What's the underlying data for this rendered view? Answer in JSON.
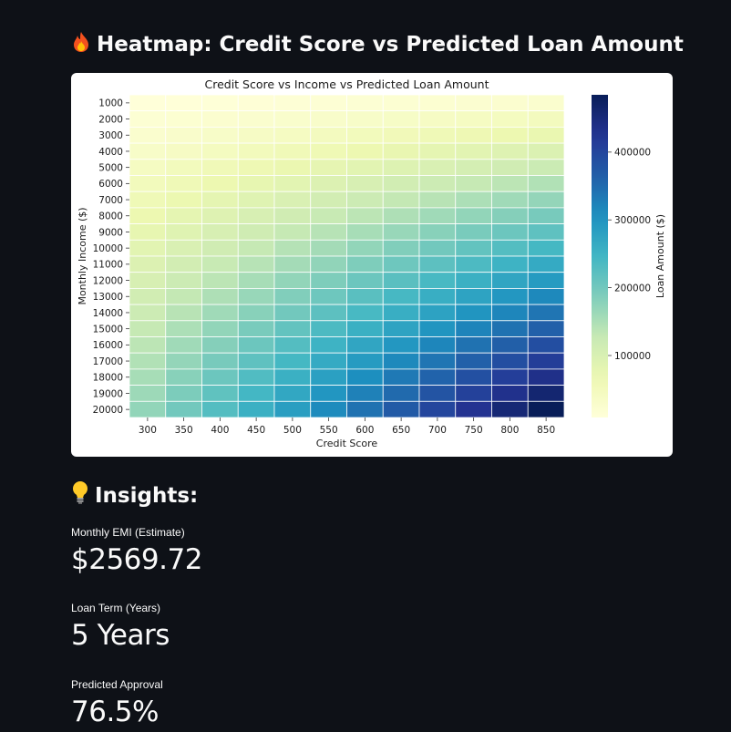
{
  "page": {
    "heatmap_heading": "Heatmap: Credit Score vs Predicted Loan Amount",
    "insights_heading": "Insights:"
  },
  "icons": {
    "heatmap_heading": "fire-icon",
    "insights_heading": "lightbulb-icon"
  },
  "metrics": [
    {
      "label": "Monthly EMI (Estimate)",
      "value": "$2569.72"
    },
    {
      "label": "Loan Term (Years)",
      "value": "5 Years"
    },
    {
      "label": "Predicted Approval",
      "value": "76.5%"
    }
  ],
  "chart_data": {
    "type": "heatmap",
    "title": "Credit Score vs Income vs Predicted Loan Amount",
    "xlabel": "Credit Score",
    "ylabel": "Monthly Income ($)",
    "colorbar_label": "Loan Amount ($)",
    "colormap": "YlGnBu",
    "x": [
      300,
      350,
      400,
      450,
      500,
      550,
      600,
      650,
      700,
      750,
      800,
      850
    ],
    "y": [
      1000,
      2000,
      3000,
      4000,
      5000,
      6000,
      7000,
      8000,
      9000,
      10000,
      11000,
      12000,
      13000,
      14000,
      15000,
      16000,
      17000,
      18000,
      19000,
      20000
    ],
    "value_formula": "loan_amount = 0.0285 * credit_score * monthly_income (approx., read off colors)",
    "values": [
      [
        8550,
        9975,
        11400,
        12825,
        14250,
        15675,
        17100,
        18525,
        19950,
        21375,
        22800,
        24225
      ],
      [
        17100,
        19950,
        22800,
        25650,
        28500,
        31350,
        34200,
        37050,
        39900,
        42750,
        45600,
        48450
      ],
      [
        25650,
        29925,
        34200,
        38475,
        42750,
        47025,
        51300,
        55575,
        59850,
        64125,
        68400,
        72675
      ],
      [
        34200,
        39900,
        45600,
        51300,
        57000,
        62700,
        68400,
        74100,
        79800,
        85500,
        91200,
        96900
      ],
      [
        42750,
        49875,
        57000,
        64125,
        71250,
        78375,
        85500,
        92625,
        99750,
        106875,
        114000,
        121125
      ],
      [
        51300,
        59850,
        68400,
        76950,
        85500,
        94050,
        102600,
        111150,
        119700,
        128250,
        136800,
        145350
      ],
      [
        59850,
        69825,
        79800,
        89775,
        99750,
        109725,
        119700,
        129675,
        139650,
        149625,
        159600,
        169575
      ],
      [
        68400,
        79800,
        91200,
        102600,
        114000,
        125400,
        136800,
        148200,
        159600,
        171000,
        182400,
        193800
      ],
      [
        76950,
        89775,
        102600,
        115425,
        128250,
        141075,
        153900,
        166725,
        179550,
        192375,
        205200,
        218025
      ],
      [
        85500,
        99750,
        114000,
        128250,
        142500,
        156750,
        171000,
        185250,
        199500,
        213750,
        228000,
        242250
      ],
      [
        94050,
        109725,
        125400,
        141075,
        156750,
        172425,
        188100,
        203775,
        219450,
        235125,
        250800,
        266475
      ],
      [
        102600,
        119700,
        136800,
        153900,
        171000,
        188100,
        205200,
        222300,
        239400,
        256500,
        273600,
        290700
      ],
      [
        111150,
        129675,
        148200,
        166725,
        185250,
        203775,
        222300,
        240825,
        259350,
        277875,
        296400,
        314925
      ],
      [
        119700,
        139650,
        159600,
        179550,
        199500,
        219450,
        239400,
        259350,
        279300,
        299250,
        319200,
        339150
      ],
      [
        128250,
        149625,
        171000,
        192375,
        213750,
        235125,
        256500,
        277875,
        299250,
        320625,
        342000,
        363375
      ],
      [
        136800,
        159600,
        182400,
        205200,
        228000,
        250800,
        273600,
        296400,
        319200,
        342000,
        364800,
        387600
      ],
      [
        145350,
        169575,
        193800,
        218025,
        242250,
        266475,
        290700,
        314925,
        339150,
        363375,
        387600,
        411825
      ],
      [
        153900,
        179550,
        205200,
        230850,
        256500,
        282150,
        307800,
        333450,
        359100,
        384750,
        410400,
        436050
      ],
      [
        162450,
        189525,
        216600,
        243675,
        270750,
        297825,
        324900,
        351975,
        379050,
        406125,
        433200,
        460275
      ],
      [
        171000,
        199500,
        228000,
        256500,
        285000,
        313500,
        342000,
        370500,
        399000,
        427500,
        456000,
        484500
      ]
    ],
    "colorbar_ticks": [
      100000,
      200000,
      300000,
      400000
    ],
    "colorbar_range": [
      8550,
      484500
    ]
  }
}
